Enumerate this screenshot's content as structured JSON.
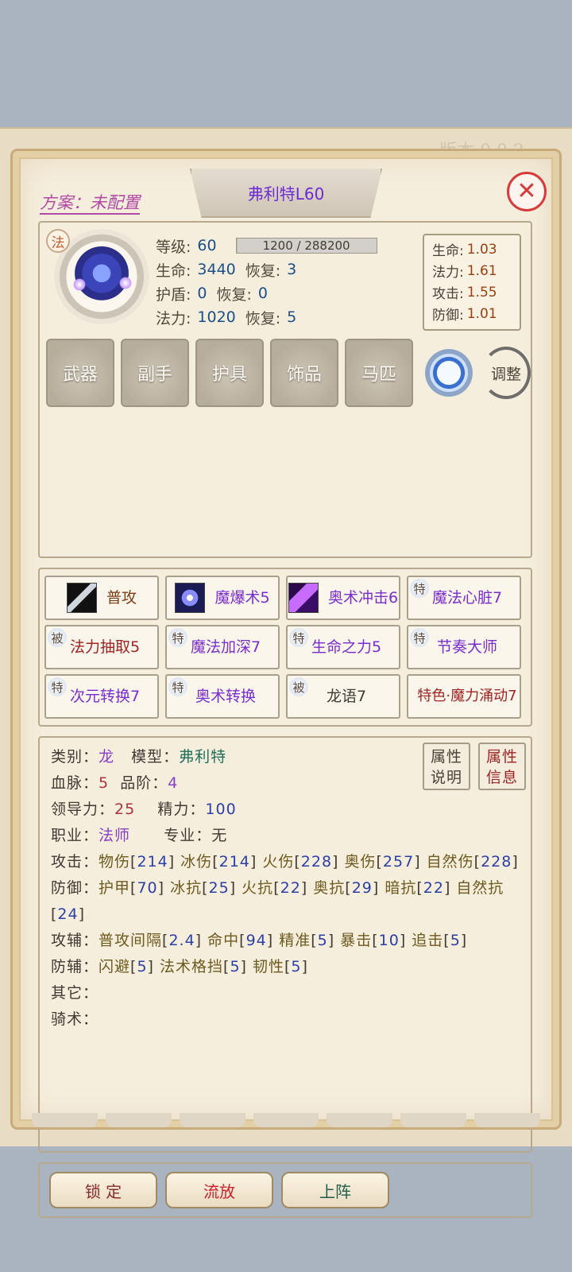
{
  "frame_watermark": "版本 0.0.2",
  "plan_label": "方案：未配置",
  "hero_name": "弗利特L60",
  "close_glyph": "✕",
  "class_badge": "法",
  "stats": {
    "level_label": "等级:",
    "level_value": "60",
    "xp_text": "1200 / 288200",
    "xp_fraction": 0.0042,
    "hp_label": "生命:",
    "hp_value": "3440",
    "hp_regen_label": "恢复:",
    "hp_regen_value": "3",
    "shield_label": "护盾:",
    "shield_value": "0",
    "shield_regen_label": "恢复:",
    "shield_regen_value": "0",
    "mana_label": "法力:",
    "mana_value": "1020",
    "mana_regen_label": "恢复:",
    "mana_regen_value": "5"
  },
  "multipliers": [
    {
      "label": "生命:",
      "value": "1.03"
    },
    {
      "label": "法力:",
      "value": "1.61"
    },
    {
      "label": "攻击:",
      "value": "1.55"
    },
    {
      "label": "防御:",
      "value": "1.01"
    }
  ],
  "equipment": [
    "武器",
    "副手",
    "护具",
    "饰品",
    "马匹"
  ],
  "adjust_label": "调整",
  "skills": [
    {
      "badge": "",
      "icon": "sword-skill-icon",
      "label": "普攻",
      "color": "brown"
    },
    {
      "badge": "",
      "icon": "magic-burst-skill-icon",
      "label": "魔爆术5",
      "color": "purple"
    },
    {
      "badge": "",
      "icon": "arcane-strike-skill-icon",
      "label": "奥术冲击6",
      "color": "purple"
    },
    {
      "badge": "特",
      "icon": "",
      "label": "魔法心脏7",
      "color": "purple"
    },
    {
      "badge": "被",
      "icon": "",
      "label": "法力抽取5",
      "color": "red"
    },
    {
      "badge": "特",
      "icon": "",
      "label": "魔法加深7",
      "color": "purple"
    },
    {
      "badge": "特",
      "icon": "",
      "label": "生命之力5",
      "color": "purple"
    },
    {
      "badge": "特",
      "icon": "",
      "label": "节奏大师",
      "color": "purple"
    },
    {
      "badge": "特",
      "icon": "",
      "label": "次元转换7",
      "color": "purple"
    },
    {
      "badge": "特",
      "icon": "",
      "label": "奥术转换",
      "color": "purple"
    },
    {
      "badge": "被",
      "icon": "",
      "label": "龙语7",
      "color": "dark"
    },
    {
      "badge": "",
      "icon": "",
      "label": "特色·魔力涌动7",
      "color": "red"
    }
  ],
  "info": {
    "attr_explain": "属性说明",
    "attr_info": "属性信息",
    "category_label": "类别：",
    "category_value": "龙",
    "model_label": "模型：",
    "model_value": "弗利特",
    "bloodline_label": "血脉：",
    "bloodline_value": "5",
    "grade_label": "品阶：",
    "grade_value": "4",
    "leadership_label": "领导力：",
    "leadership_value": "25",
    "energy_label": "精力：",
    "energy_value": "100",
    "job_label": "职业：",
    "job_value": "法师",
    "spec_label": "专业：",
    "spec_value": "无",
    "attack_label": "攻击：",
    "attack": [
      {
        "name": "物伤",
        "value": "214"
      },
      {
        "name": "冰伤",
        "value": "214"
      },
      {
        "name": "火伤",
        "value": "228"
      },
      {
        "name": "奥伤",
        "value": "257"
      },
      {
        "name": "自然伤",
        "value": "228"
      }
    ],
    "defense_label": "防御：",
    "defense": [
      {
        "name": "护甲",
        "value": "70"
      },
      {
        "name": "冰抗",
        "value": "25"
      },
      {
        "name": "火抗",
        "value": "22"
      },
      {
        "name": "奥抗",
        "value": "29"
      },
      {
        "name": "暗抗",
        "value": "22"
      },
      {
        "name": "自然抗",
        "value": "24"
      }
    ],
    "attack_aux_label": "攻辅：",
    "attack_aux": [
      {
        "name": "普攻间隔",
        "value": "2.4"
      },
      {
        "name": "命中",
        "value": "94"
      },
      {
        "name": "精准",
        "value": "5"
      },
      {
        "name": "暴击",
        "value": "10"
      },
      {
        "name": "追击",
        "value": "5"
      }
    ],
    "defense_aux_label": "防辅：",
    "defense_aux": [
      {
        "name": "闪避",
        "value": "5"
      },
      {
        "name": "法术格挡",
        "value": "5"
      },
      {
        "name": "韧性",
        "value": "5"
      }
    ],
    "other_label": "其它：",
    "riding_label": "骑术："
  },
  "actions": {
    "lock": "锁 定",
    "exile": "流放",
    "deploy": "上阵"
  },
  "colors": {
    "parchment": "#f6eedd",
    "border": "#b6a98e",
    "close_red": "#d83a3a",
    "name_purple": "#6b2bd6"
  }
}
